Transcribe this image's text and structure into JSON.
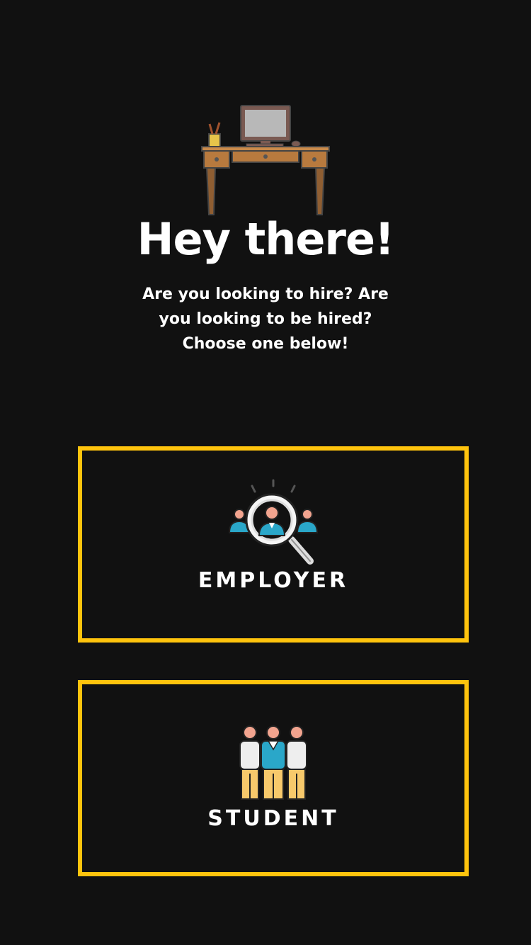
{
  "welcome": {
    "title": "Hey there!",
    "subtitle_lines": [
      "Are you looking to hire? Are",
      "you looking to be hired?",
      "Choose one below!"
    ]
  },
  "roles": {
    "employer": {
      "label": "EMPLOYER",
      "icon": "magnifier-people-icon"
    },
    "student": {
      "label": "STUDENT",
      "icon": "students-group-icon"
    }
  },
  "theme": {
    "background": "#111111",
    "accent": "#ffc40d",
    "text": "#ffffff"
  }
}
